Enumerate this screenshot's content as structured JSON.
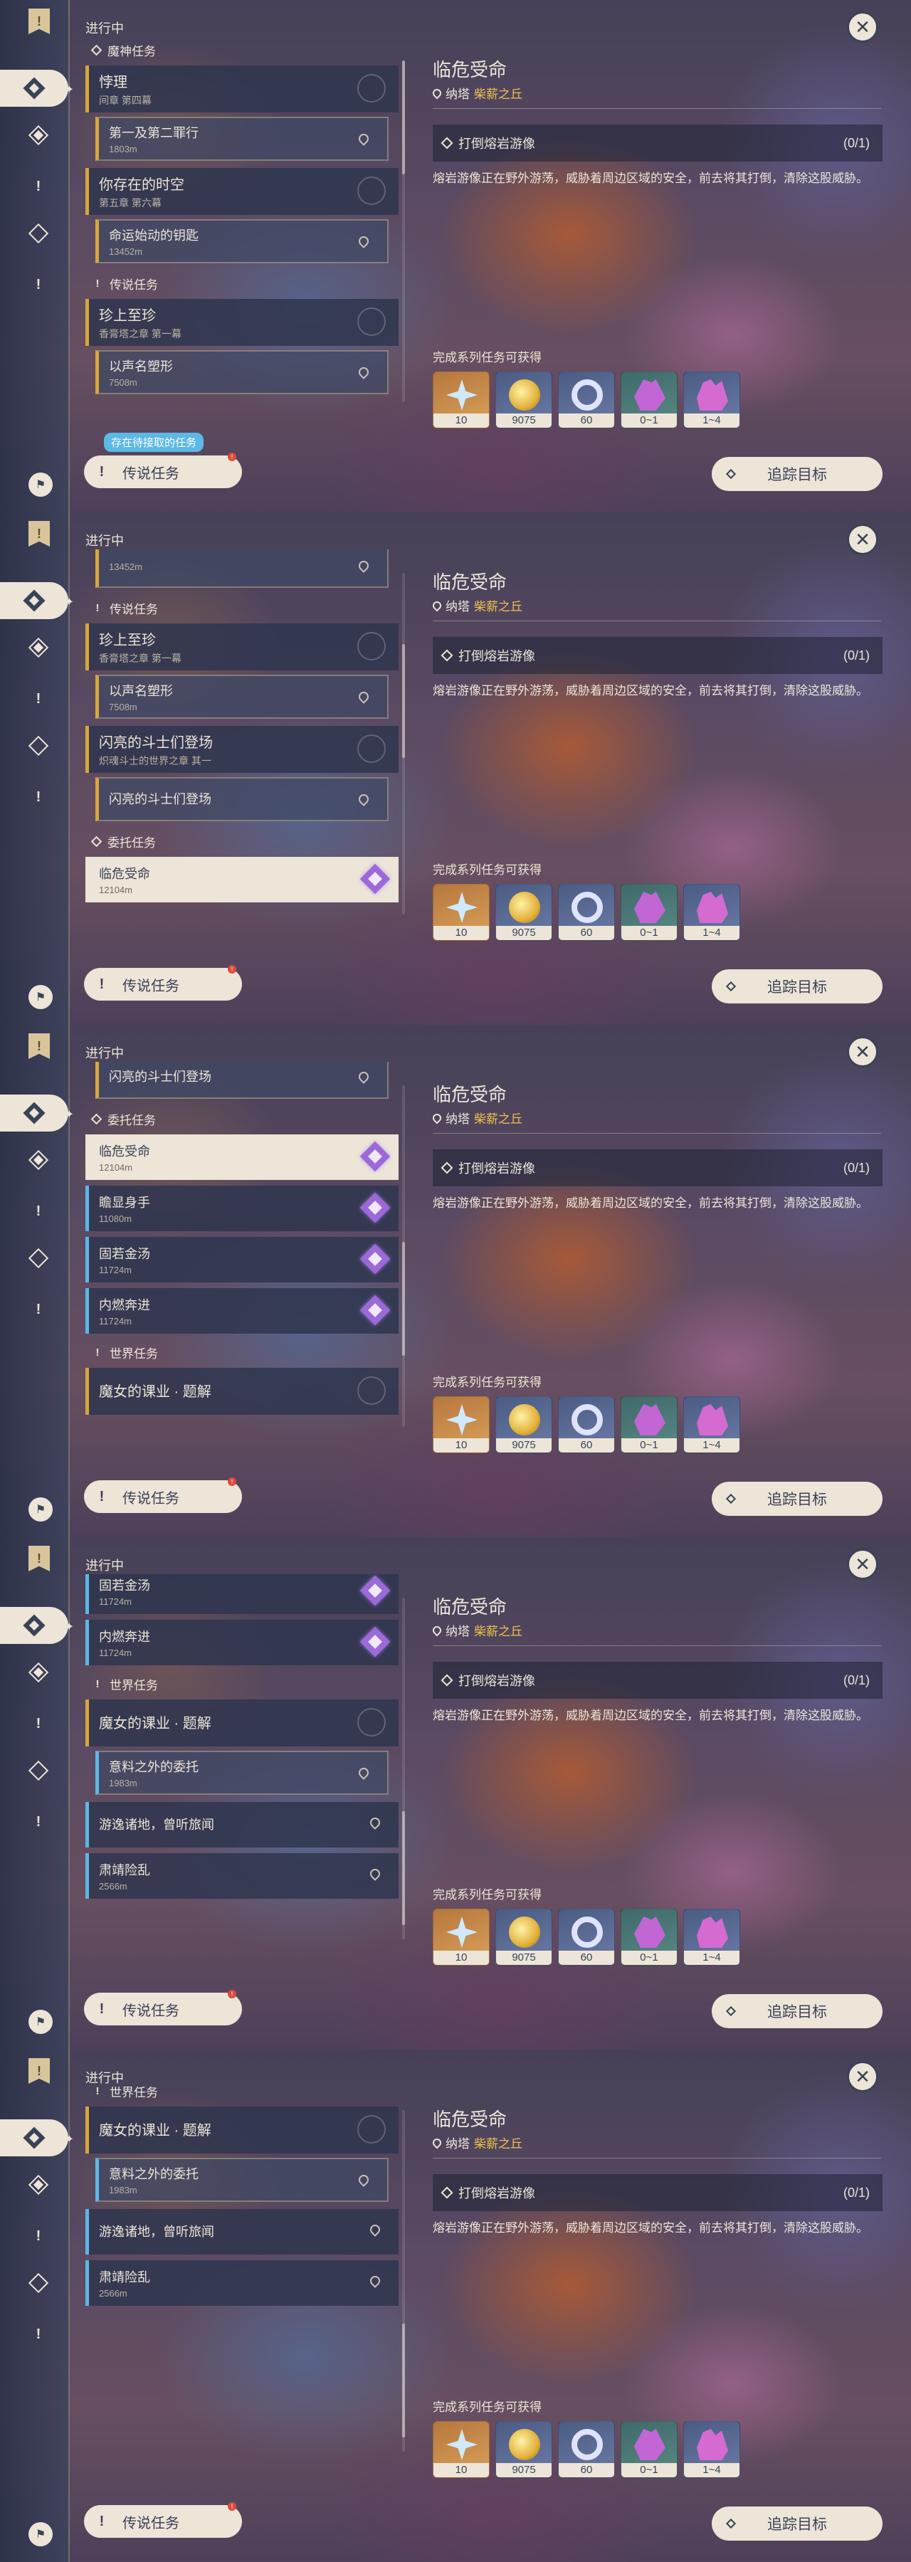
{
  "common": {
    "in_progress": "进行中",
    "legend_button": "传说任务",
    "track_button": "追踪目标",
    "close_symbol": "✕",
    "legend_badge": "!",
    "pending_tooltip": "存在待接取的任务",
    "icons": {
      "close": "close-icon",
      "bookmark": "bookmark-icon",
      "legend": "exclamation-icon",
      "commission": "diamond-icon",
      "archon": "diamond-icon"
    },
    "colors": {
      "accent_cream": "#ece5d8",
      "archon_gold": "#d9a63a",
      "world_blue": "#5cb8e6",
      "commission_purple": "#9b6ad8",
      "location_yellow": "#f0c24d"
    }
  },
  "detail": {
    "title": "临危受命",
    "location_nation": "纳塔",
    "location_area": "柴薪之丘",
    "objective": "打倒熔岩游像",
    "objective_count": "(0/1)",
    "description": "熔岩游像正在野外游荡，威胁着周边区域的安全，前去将其打倒，清除这股威胁。",
    "reward_label": "完成系列任务可获得",
    "rewards": [
      {
        "name": "primogem",
        "value": "10"
      },
      {
        "name": "mora",
        "value": "9075"
      },
      {
        "name": "adventure-exp",
        "value": "60"
      },
      {
        "name": "crystal-a",
        "value": "0~1"
      },
      {
        "name": "crystal-b",
        "value": "1~4"
      }
    ]
  },
  "frames": [
    {
      "sections": [
        {
          "type": "section",
          "icon": "dia",
          "label": "魔神任务"
        },
        {
          "type": "quest",
          "title": "悖理",
          "sub": "间章 第四幕"
        },
        {
          "type": "sub",
          "title": "第一及第二罪行",
          "sub": "1803m"
        },
        {
          "type": "quest",
          "title": "你存在的时空",
          "sub": "第五章 第六幕"
        },
        {
          "type": "sub",
          "title": "命运始动的钥匙",
          "sub": "13452m"
        },
        {
          "type": "section",
          "icon": "ex",
          "label": "传说任务"
        },
        {
          "type": "quest",
          "title": "珍上至珍",
          "sub": "香膏塔之章 第一幕"
        },
        {
          "type": "sub",
          "title": "以声名塑形",
          "sub": "7508m"
        }
      ],
      "tooltip": true
    },
    {
      "sections": [
        {
          "type": "sub",
          "title": "",
          "sub": "13452m"
        },
        {
          "type": "section",
          "icon": "ex",
          "label": "传说任务"
        },
        {
          "type": "quest",
          "title": "珍上至珍",
          "sub": "香膏塔之章 第一幕"
        },
        {
          "type": "sub",
          "title": "以声名塑形",
          "sub": "7508m"
        },
        {
          "type": "quest",
          "title": "闪亮的斗士们登场",
          "sub": "炽魂斗士的世界之章 其一"
        },
        {
          "type": "sub",
          "title": "闪亮的斗士们登场",
          "sub": ""
        },
        {
          "type": "section",
          "icon": "dia",
          "label": "委托任务"
        },
        {
          "type": "commission",
          "title": "临危受命",
          "sub": "12104m",
          "selected": true
        }
      ]
    },
    {
      "sections": [
        {
          "type": "sub",
          "title": "闪亮的斗士们登场",
          "sub": ""
        },
        {
          "type": "section",
          "icon": "dia",
          "label": "委托任务"
        },
        {
          "type": "commission",
          "title": "临危受命",
          "sub": "12104m",
          "selected": true
        },
        {
          "type": "commission",
          "title": "瞻显身手",
          "sub": "11080m"
        },
        {
          "type": "commission",
          "title": "固若金汤",
          "sub": "11724m"
        },
        {
          "type": "commission",
          "title": "内燃奔进",
          "sub": "11724m"
        },
        {
          "type": "section",
          "icon": "ex",
          "label": "世界任务"
        },
        {
          "type": "quest",
          "title": "魔女的课业 · 题解",
          "sub": ""
        }
      ]
    },
    {
      "sections": [
        {
          "type": "commission",
          "title": "固若金汤",
          "sub": "11724m"
        },
        {
          "type": "commission",
          "title": "内燃奔进",
          "sub": "11724m"
        },
        {
          "type": "section",
          "icon": "ex",
          "label": "世界任务"
        },
        {
          "type": "quest",
          "title": "魔女的课业 · 题解",
          "sub": ""
        },
        {
          "type": "sub-blue",
          "title": "意料之外的委托",
          "sub": "1983m"
        },
        {
          "type": "world",
          "title": "游逸诸地，曾听旅闻",
          "sub": ""
        },
        {
          "type": "world",
          "title": "肃靖险乱",
          "sub": "2566m"
        }
      ]
    },
    {
      "sections": [
        {
          "type": "section",
          "icon": "ex",
          "label": "世界任务"
        },
        {
          "type": "quest",
          "title": "魔女的课业 · 题解",
          "sub": ""
        },
        {
          "type": "sub-blue",
          "title": "意料之外的委托",
          "sub": "1983m"
        },
        {
          "type": "world",
          "title": "游逸诸地，曾听旅闻",
          "sub": ""
        },
        {
          "type": "world",
          "title": "肃靖险乱",
          "sub": "2566m"
        }
      ]
    }
  ]
}
